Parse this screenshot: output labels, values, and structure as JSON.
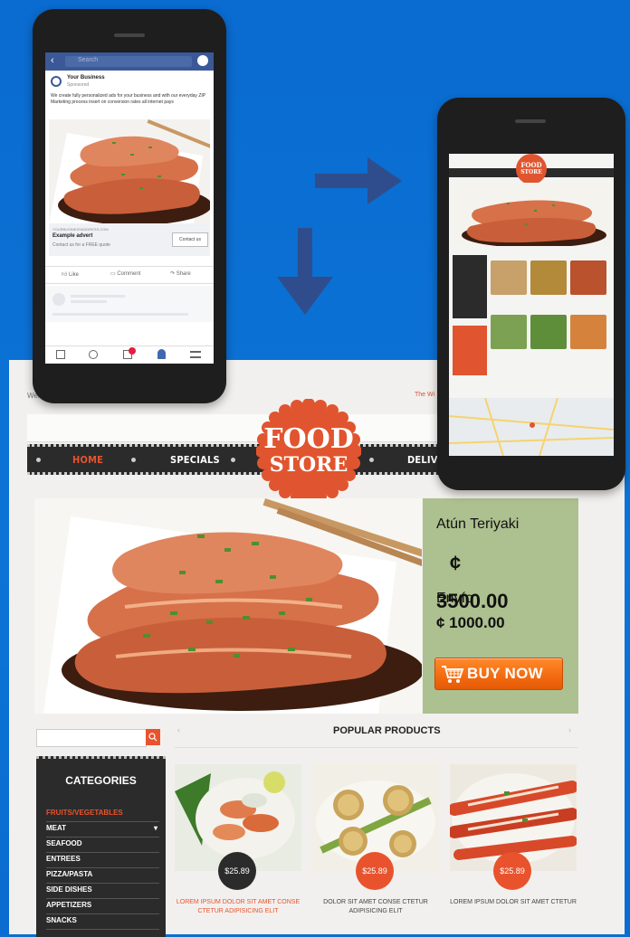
{
  "colors": {
    "background": "#0b6fd0",
    "accent": "#e8532d",
    "nav": "#2b2b2b",
    "offer_panel": "#adc08f",
    "fb_blue": "#3b5998"
  },
  "fb_phone": {
    "search_placeholder": "Search",
    "business_name": "Your Business",
    "sponsored": "Sponsored",
    "post_text": "We create fully personalized ads for your business and with our everyday ZIP Marketing process insert on conversion rates all internet pays",
    "link_domain": "YOURBUSINESSADDRESS.COM",
    "link_title": "Example advert",
    "link_desc": "Contact us for a FREE quote",
    "cta": "Contact us",
    "actions": [
      "Like",
      "Comment",
      "Share"
    ],
    "icons": [
      "news-feed-icon",
      "friends-icon",
      "marketplace-icon",
      "notifications-icon",
      "menu-icon"
    ]
  },
  "site": {
    "welcome": "Welc",
    "promo": "The Wi",
    "logo_line1": "FOOD",
    "logo_line2": "STORE",
    "nav": [
      "HOME",
      "SPECIALS",
      "DELIVERY"
    ]
  },
  "offer": {
    "product": "Atún Teriyaki",
    "price": "¢ 3500.00",
    "shipping_label": "Envío",
    "shipping_price": "¢ 1000.00",
    "buy": "BUY NOW"
  },
  "categories": {
    "title": "CATEGORIES",
    "items": [
      "FRUITS/VEGETABLES",
      "MEAT",
      "SEAFOOD",
      "ENTREES",
      "PIZZA/PASTA",
      "SIDE DISHES",
      "APPETIZERS",
      "SNACKS"
    ]
  },
  "popular": {
    "title": "POPULAR PRODUCTS",
    "products": [
      {
        "price": "$25.89",
        "caption": "LOREM IPSUM DOLOR SIT AMET CONSE CTETUR ADIPISICING ELIT"
      },
      {
        "price": "$25.89",
        "caption": "DOLOR SIT AMET CONSE CTETUR ADIPISICING ELIT"
      },
      {
        "price": "$25.89",
        "caption": "LOREM IPSUM DOLOR SIT AMET CTETUR"
      }
    ]
  }
}
